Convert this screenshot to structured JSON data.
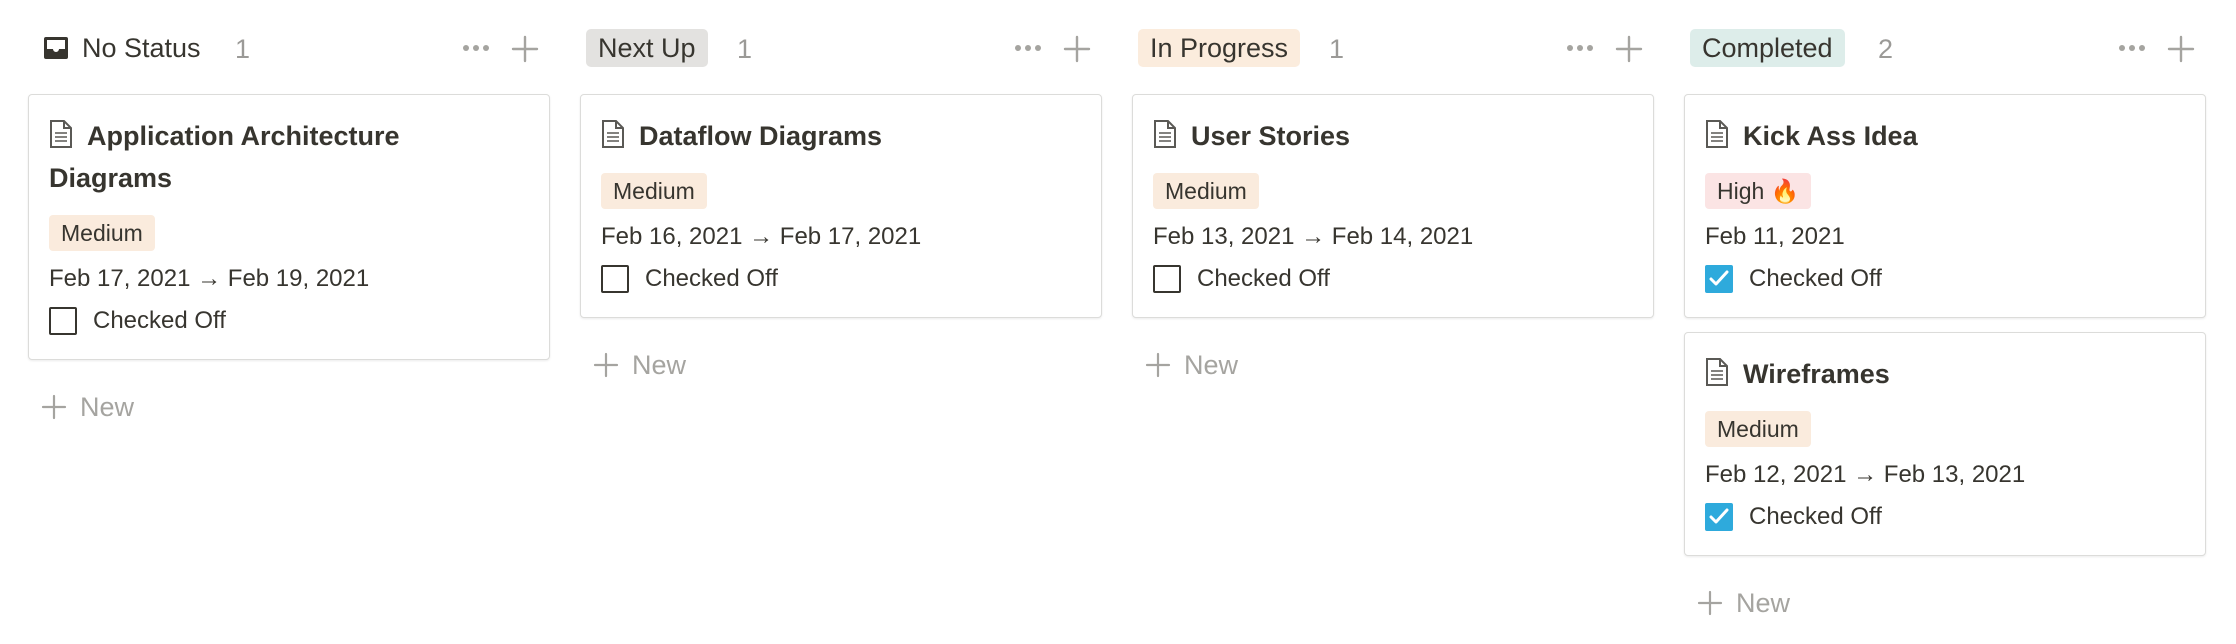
{
  "columns": [
    {
      "title": "No Status",
      "count": "1",
      "title_bg": "",
      "icon": "inbox-icon",
      "new_label": "New",
      "cards": [
        {
          "title": "Application Architecture Diagrams",
          "tag": "Medium",
          "tag_color": "#faebdd",
          "date": "Feb 17, 2021 → Feb 19, 2021",
          "check_label": "Checked Off",
          "checked": false
        }
      ]
    },
    {
      "title": "Next Up",
      "count": "1",
      "title_bg": "#e3e2e0",
      "new_label": "New",
      "cards": [
        {
          "title": "Dataflow Diagrams",
          "tag": "Medium",
          "tag_color": "#faebdd",
          "date": "Feb 16, 2021 → Feb 17, 2021",
          "check_label": "Checked Off",
          "checked": false
        }
      ]
    },
    {
      "title": "In Progress",
      "count": "1",
      "title_bg": "#fbecdd",
      "new_label": "New",
      "cards": [
        {
          "title": "User Stories",
          "tag": "Medium",
          "tag_color": "#faebdd",
          "date": "Feb 13, 2021 → Feb 14, 2021",
          "check_label": "Checked Off",
          "checked": false
        }
      ]
    },
    {
      "title": "Completed",
      "count": "2",
      "title_bg": "#ddedea",
      "new_label": "New",
      "cards": [
        {
          "title": "Kick Ass Idea",
          "tag": "High 🔥",
          "tag_color": "#fbe4e4",
          "date": "Feb 11, 2021",
          "check_label": "Checked Off",
          "checked": true
        },
        {
          "title": "Wireframes",
          "tag": "Medium",
          "tag_color": "#faebdd",
          "date": "Feb 12, 2021 → Feb 13, 2021",
          "check_label": "Checked Off",
          "checked": true
        }
      ]
    }
  ],
  "colors": {
    "checkbox_checked": "#2eaadc",
    "text": "#37352f",
    "muted": "#9b9a97"
  }
}
